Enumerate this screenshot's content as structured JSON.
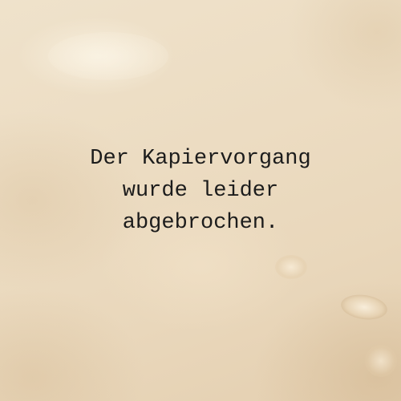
{
  "message": {
    "lines": [
      "Der Kapiervorgang",
      "wurde leider",
      "abgebrochen."
    ]
  }
}
